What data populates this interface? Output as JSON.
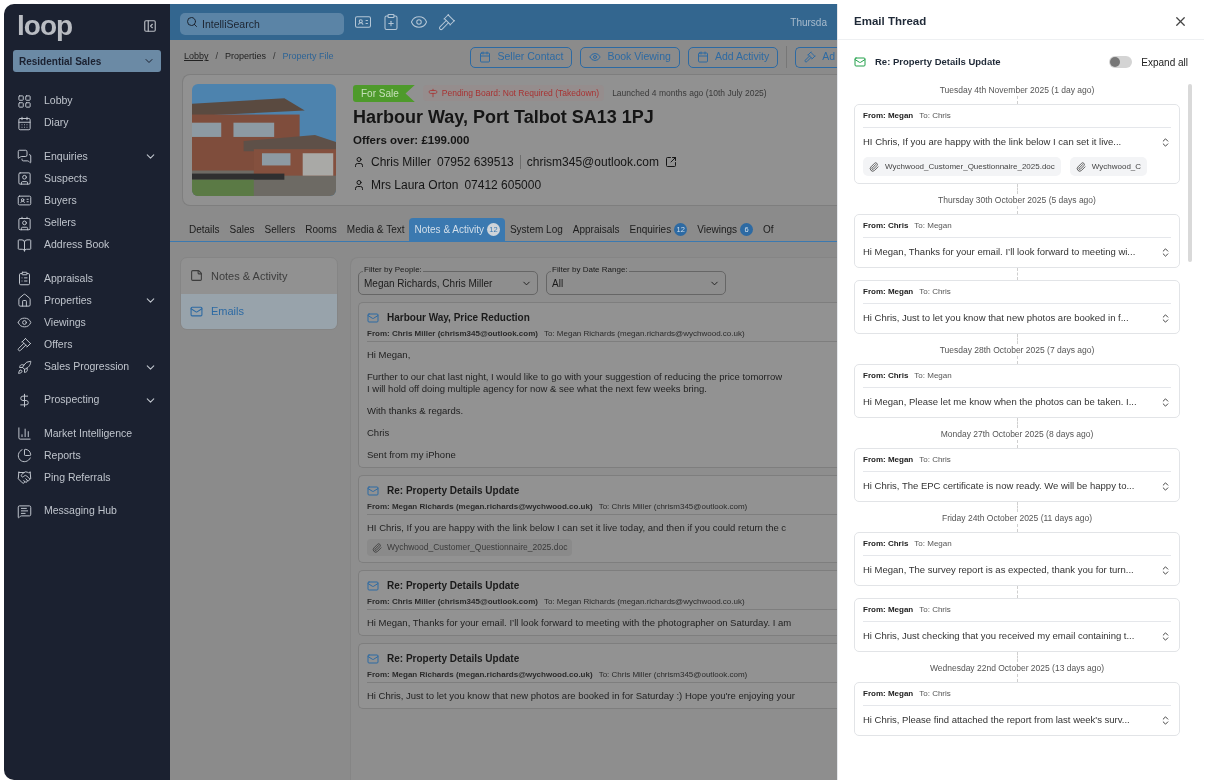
{
  "sidebar": {
    "logo": "loop",
    "workspace": "Residential Sales",
    "groups": [
      [
        {
          "label": "Lobby",
          "has_submenu": false
        },
        {
          "label": "Diary",
          "has_submenu": false
        }
      ],
      [
        {
          "label": "Enquiries",
          "has_submenu": true
        },
        {
          "label": "Suspects",
          "has_submenu": false
        },
        {
          "label": "Buyers",
          "has_submenu": false
        },
        {
          "label": "Sellers",
          "has_submenu": false
        },
        {
          "label": "Address Book",
          "has_submenu": false
        }
      ],
      [
        {
          "label": "Appraisals",
          "has_submenu": false
        },
        {
          "label": "Properties",
          "has_submenu": true
        },
        {
          "label": "Viewings",
          "has_submenu": false
        },
        {
          "label": "Offers",
          "has_submenu": false
        },
        {
          "label": "Sales Progression",
          "has_submenu": true
        }
      ],
      [
        {
          "label": "Prospecting",
          "has_submenu": true
        }
      ],
      [
        {
          "label": "Market Intelligence",
          "has_submenu": false
        },
        {
          "label": "Reports",
          "has_submenu": false
        },
        {
          "label": "Ping Referrals",
          "has_submenu": false
        }
      ],
      [
        {
          "label": "Messaging Hub",
          "has_submenu": false
        }
      ]
    ]
  },
  "top_bar": {
    "search": {
      "placeholder": "IntelliSearch"
    },
    "date": "Thursda"
  },
  "breadcrumbs": [
    {
      "label": "Lobby",
      "current": false
    },
    {
      "separator": "/",
      "label": "Properties",
      "current": false
    },
    {
      "separator": "/",
      "label": "Property File",
      "current": true
    }
  ],
  "actions": [
    "Seller Contact",
    "Book Viewing",
    "Add Activity",
    "Ad"
  ],
  "property": {
    "status": "For Sale",
    "board": "Pending Board: Not Required (Takedown)",
    "launched": "Launched 4 months ago (10th July 2025)",
    "address": "Harbour Way, Port Talbot SA13 1PJ",
    "price": "Offers over: £199.000",
    "contacts": [
      {
        "name": "Chris Miller",
        "phone": "07952 639513",
        "email": "chrism345@outlook.com"
      },
      {
        "name": "Mrs Laura Orton",
        "phone": "07412 605000"
      }
    ]
  },
  "tabs": [
    {
      "label": "Details",
      "selected": false
    },
    {
      "label": "Sales",
      "selected": false
    },
    {
      "label": "Sellers",
      "selected": false
    },
    {
      "label": "Rooms",
      "selected": false
    },
    {
      "label": "Media & Text",
      "selected": false
    },
    {
      "label": "Notes & Activity",
      "count": "12",
      "selected": true
    },
    {
      "label": "System Log",
      "selected": false
    },
    {
      "label": "Appraisals",
      "selected": false
    },
    {
      "label": "Enquiries",
      "count": "12",
      "selected": false
    },
    {
      "label": "Viewings",
      "count": "6",
      "selected": false
    },
    {
      "label": "Of",
      "selected": false
    }
  ],
  "subnav": [
    {
      "label": "Notes & Activity",
      "selected": false
    },
    {
      "label": "Emails",
      "selected": true
    }
  ],
  "filters": [
    {
      "label": "Filter by People:",
      "value": "Megan Richards, Chris Miller"
    },
    {
      "label": "Filter by Date Range:",
      "value": "All"
    }
  ],
  "emails": [
    {
      "subject": "Harbour Way, Price Reduction",
      "from": "From: Chris Miller (chrism345@outlook.com)",
      "to": "To: Megan Richards (megan.richards@wychwood.co.uk)",
      "body": [
        [
          "Hi Megan,"
        ],
        [
          "Further to our chat last night, I would like to go with your suggestion of reducing the price tomorrow",
          "I will hold off doing multiple agency for now & see what the next few weeks bring."
        ],
        [
          "With thanks & regards."
        ],
        [
          "Chris"
        ],
        [
          "Sent from my iPhone"
        ]
      ]
    },
    {
      "subject": "Re: Property Details Update",
      "from": "From: Megan Richards (megan.richards@wychwood.co.uk)",
      "to": "To: Chris Miller (chrism345@outlook.com)",
      "body": [
        [
          "HI Chris, If you are happy with the link below I can set it live today, and then if you could return the c"
        ]
      ],
      "attachments": [
        "Wychwood_Customer_Questionnaire_2025.doc"
      ]
    },
    {
      "subject": "Re: Property Details Update",
      "from": "From: Chris Miller (chrism345@outlook.com)",
      "to": "To: Megan Richards (megan.richards@wychwood.co.uk)",
      "body": [
        [
          "Hi Megan, Thanks for your email. I’ll look forward to meeting with the photographer on Saturday. I am"
        ]
      ]
    },
    {
      "subject": "Re: Property Details Update",
      "from": "From: Megan Richards (megan.richards@wychwood.co.uk)",
      "to": "To: Chris Miller (chrism345@outlook.com)",
      "body": [
        [
          "Hi Chris, Just to let you know that new photos are booked in for Saturday :) Hope you're enjoying your"
        ]
      ]
    }
  ],
  "thread": {
    "title": "Email Thread",
    "subject": "Re: Property Details Update",
    "expand_all": {
      "label": "Expand all",
      "on": false
    },
    "days": [
      {
        "date": "Tuesday 4th November 2025 (1 day ago)",
        "messages": [
          {
            "from": "From: Megan",
            "to": "To: Chris",
            "preview": "HI Chris, If you are happy with the link below I can set it live...",
            "attachments": [
              "Wychwood_Customer_Questionnaire_2025.doc",
              "Wychwood_C"
            ]
          }
        ]
      },
      {
        "date": "Thursday 30th October 2025 (5 days ago)",
        "messages": [
          {
            "from": "From: Chris",
            "to": "To: Megan",
            "preview": "Hi Megan, Thanks for your email. I’ll look forward to meeting wi..."
          },
          {
            "from": "From: Megan",
            "to": "To: Chris",
            "preview": "Hi Chris, Just to let you know that new photos are booked in f..."
          }
        ]
      },
      {
        "date": "Tuesday 28th October 2025 (7 days ago)",
        "messages": [
          {
            "from": "From: Chris",
            "to": "To: Megan",
            "preview": "Hi Megan, Please let me know when the photos can be taken. I..."
          }
        ]
      },
      {
        "date": "Monday 27th October 2025 (8 days ago)",
        "messages": [
          {
            "from": "From: Megan",
            "to": "To: Chris",
            "preview": "Hi Chris, The EPC certificate is now ready. We will be happy to..."
          }
        ]
      },
      {
        "date": "Friday 24th October 2025 (11 days ago)",
        "messages": [
          {
            "from": "From: Chris",
            "to": "To: Megan",
            "preview": "Hi Megan, The survey report is as expected, thank you for turn..."
          },
          {
            "from": "From: Megan",
            "to": "To: Chris",
            "preview": "Hi Chris, Just checking that you received my email containing t..."
          }
        ]
      },
      {
        "date": "Wednesday 22nd October 2025 (13 days ago)",
        "messages": [
          {
            "from": "From: Megan",
            "to": "To: Chris",
            "preview": "Hi Chris, Please find attached the report from last week's surv..."
          }
        ]
      }
    ]
  }
}
